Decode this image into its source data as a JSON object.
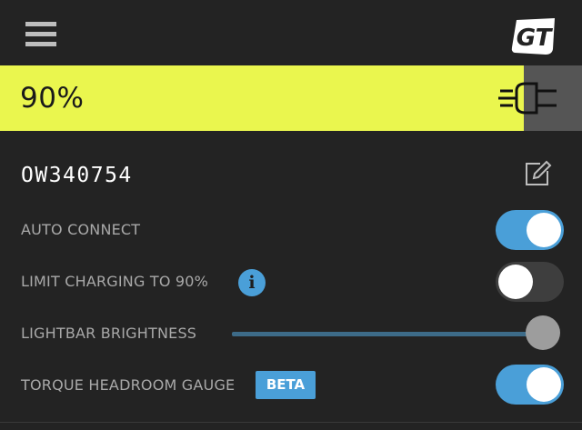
{
  "header": {
    "menu_icon": "hamburger-menu-icon",
    "logo_text": "GT"
  },
  "battery": {
    "percent_label": "90%",
    "level": 0.9,
    "fill_color": "#eaf64e",
    "charging_icon": "plug-icon"
  },
  "device": {
    "name": "OW340754",
    "edit_icon": "edit-icon"
  },
  "settings": {
    "auto_connect": {
      "label": "AUTO CONNECT",
      "enabled": true
    },
    "limit_charging": {
      "label": "LIMIT CHARGING TO 90%",
      "enabled": false,
      "info_glyph": "i"
    },
    "lightbar_brightness": {
      "label": "LIGHTBAR BRIGHTNESS",
      "value": 1.0
    },
    "torque_headroom_gauge": {
      "label": "TORQUE HEADROOM GAUGE",
      "badge": "BETA",
      "enabled": true
    }
  },
  "colors": {
    "accent": "#4a9fd8",
    "background": "#232323",
    "battery_fill": "#eaf64e"
  }
}
